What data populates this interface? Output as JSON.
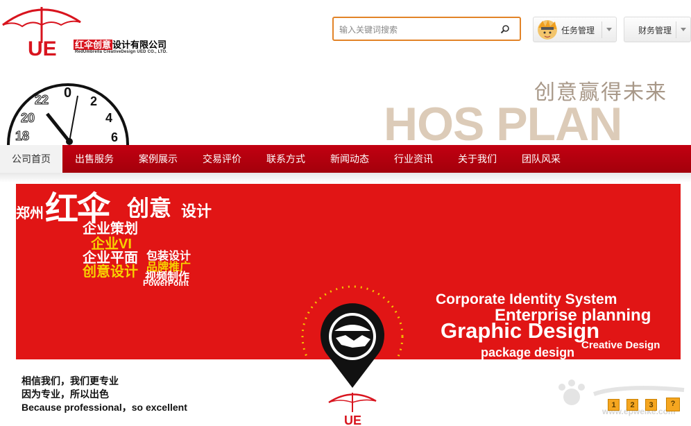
{
  "logo": {
    "mark": "UE",
    "name_highlight": "红伞创意",
    "name_rest": "设计有限公司",
    "subtitle": "RedUmbrella CreativeDesign UED CO., LTD."
  },
  "search": {
    "placeholder": "输入关键词搜索"
  },
  "header_menus": [
    {
      "label": "任务管理"
    },
    {
      "label": "财务管理"
    }
  ],
  "clock_numbers": [
    "22",
    "0",
    "2",
    "20",
    "4",
    "18",
    "6"
  ],
  "slogan": "创意赢得未来",
  "hos_plan": "HOS PLAN",
  "nav": {
    "items": [
      {
        "label": "公司首页",
        "active": true
      },
      {
        "label": "出售服务"
      },
      {
        "label": "案例展示"
      },
      {
        "label": "交易评价"
      },
      {
        "label": "联系方式"
      },
      {
        "label": "新闻动态"
      },
      {
        "label": "行业资讯"
      },
      {
        "label": "关于我们"
      },
      {
        "label": "团队风采"
      }
    ]
  },
  "banner": {
    "zhengzhou": "郑州",
    "company": "红伞",
    "creative": "创意",
    "design": "设计",
    "services": [
      "企业策划",
      "企业VI",
      "企业平面",
      "包装设计",
      "品牌推广",
      "创意设计",
      "视频制作"
    ],
    "powerpoint": "PowerPoint",
    "english": [
      "Corporate Identity System",
      "Enterprise planning",
      "Graphic Design",
      "Creative Design",
      "package design"
    ],
    "tagline": [
      "相信我们，我们更专业",
      "因为专业，所以出色",
      "Because professional，so excellent"
    ],
    "logo_mark": "UE"
  },
  "pager": [
    "1",
    "2",
    "3",
    "?"
  ],
  "watermark": {
    "url": "www.epwelke.com"
  },
  "colors": {
    "brand_red": "#d8141e",
    "nav_red": "#b5000e",
    "search_border": "#e28327"
  }
}
